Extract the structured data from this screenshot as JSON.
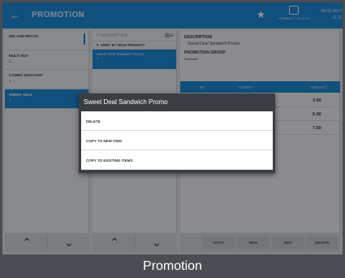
{
  "header": {
    "title": "PROMOTION",
    "connection_label": "CONNECT TO ETH",
    "date": "08-02-2017",
    "time": "11:11"
  },
  "promo_types": [
    {
      "label": "MIX AND MATCH",
      "sub": ""
    },
    {
      "label": "MULTI BUY",
      "sub": "1"
    },
    {
      "label": "COMBO DISCOUNT",
      "sub": "1"
    },
    {
      "label": "SWEET DEAL",
      "sub": "1"
    }
  ],
  "promos": {
    "search_placeholder": "DESCRIPTION",
    "sort_label": "SORT BY HIGH PRIORITY",
    "selected_name": "Sweet Deal Sandwich Promo",
    "selected_sub": "1"
  },
  "detail": {
    "description_label": "DESCRIPTION",
    "description_value": "Sweet Deal Sandwich Promo",
    "group_label": "PROMOTION GROUP",
    "group_value": "Sandwich",
    "table_headers": {
      "no": "NO",
      "count": "COUNT ↑",
      "amount": "AMOUNT ↑"
    },
    "rows": [
      {
        "amount": "3.00"
      },
      {
        "amount": "5.00"
      },
      {
        "amount": "7.00"
      }
    ],
    "buttons": {
      "goto": "GOTO",
      "new": "NEW",
      "edit": "EDIT",
      "delete": "DELETE"
    }
  },
  "modal": {
    "title": "Sweet Deal Sandwich Promo",
    "options": [
      "DELETE",
      "COPY TO NEW ITEM",
      "COPY TO EXISTING ITEMS"
    ]
  },
  "caption": "Promotion",
  "colors": {
    "accent": "#1e88d6",
    "modal_bg": "#3a3d42"
  }
}
